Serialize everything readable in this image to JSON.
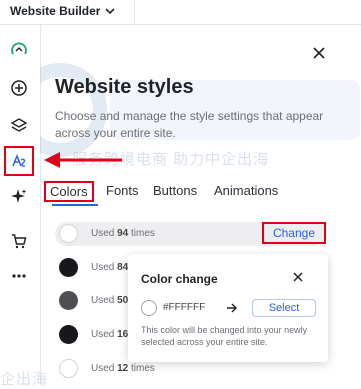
{
  "app": {
    "title": "Website Builder"
  },
  "panel": {
    "title": "Website styles",
    "description": "Choose and manage the style settings that appear across your entire site."
  },
  "tabs": [
    {
      "label": "Colors",
      "active": true
    },
    {
      "label": "Fonts",
      "active": false
    },
    {
      "label": "Buttons",
      "active": false
    },
    {
      "label": "Animations",
      "active": false
    }
  ],
  "colors": [
    {
      "swatch": "#FFFFFF",
      "prefix": "Used ",
      "count": "94",
      "suffix": " times"
    },
    {
      "swatch": "#16181b",
      "prefix": "Used ",
      "count": "84",
      "suffix": ""
    },
    {
      "swatch": "#4d4f54",
      "prefix": "Used ",
      "count": "50",
      "suffix": ""
    },
    {
      "swatch": "#16181b",
      "prefix": "Used ",
      "count": "16",
      "suffix": ""
    },
    {
      "swatch": "#FFFFFF",
      "prefix": "Used ",
      "count": "12",
      "suffix": " times"
    }
  ],
  "change_label": "Change",
  "popover": {
    "title": "Color change",
    "hex": "#FFFFFF",
    "select_label": "Select",
    "note": "This color will be changed into your newly selected across your entire site."
  },
  "watermark": {
    "line1": "服务跨境电商 助力中企出海",
    "line2": "企出海"
  },
  "theme": {
    "accent": "#2a62e0",
    "highlight": "#e00018"
  }
}
